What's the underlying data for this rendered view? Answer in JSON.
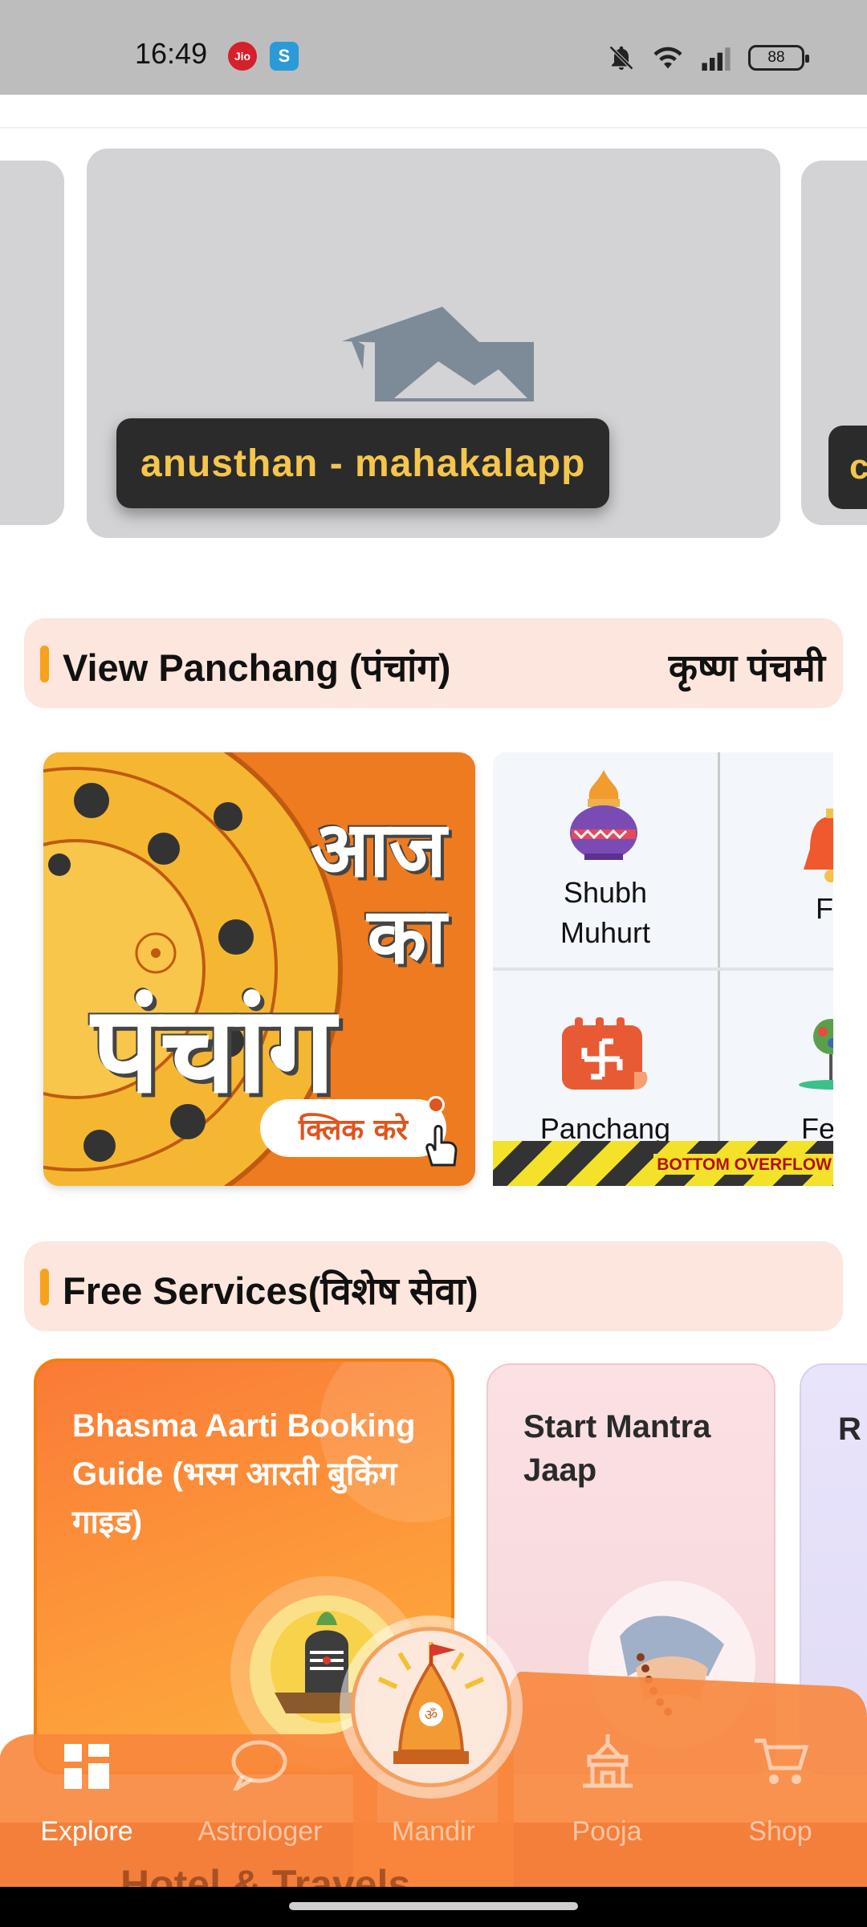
{
  "status_bar": {
    "time": "16:49",
    "carrier_badge": "Jio",
    "app_badge": "S",
    "battery": "88",
    "icons": [
      "mute-icon",
      "wifi-icon",
      "signal-icon",
      "battery-icon"
    ]
  },
  "carousel": {
    "main_caption": "anusthan - mahakalapp",
    "right_caption_partial": "c",
    "placeholder_icon": "image-placeholder-icon"
  },
  "panchang_section": {
    "title": "View Panchang (पंचांग)",
    "tithi": "कृष्ण पंचमी",
    "banner": {
      "line1": "आज",
      "line2": "का",
      "line3": "पंचांग",
      "button": "क्लिक करे"
    },
    "grid": [
      {
        "label_line1": "Shubh",
        "label_line2": "Muhurt",
        "icon": "kalash-icon"
      },
      {
        "label_line1": "Fa",
        "label_line2": "",
        "icon": "bell-icon"
      },
      {
        "label_line1": "Panchang",
        "label_line2": "",
        "icon": "calendar-swastik-icon"
      },
      {
        "label_line1": "Festi",
        "label_line2": "",
        "icon": "festival-icon"
      }
    ],
    "overflow_warning": "BOTTOM OVERFLOW"
  },
  "services_section": {
    "title": "Free Services(विशेष सेवा)",
    "cards": [
      {
        "title": "Bhasma Aarti Booking Guide (भस्म आरती बुकिंग गाइड)",
        "icon": "shivling-icon"
      },
      {
        "title": "Start Mantra Jaap",
        "icon": "prayer-beads-icon"
      },
      {
        "title": "R",
        "icon": ""
      }
    ]
  },
  "bottom_nav": {
    "items": [
      {
        "label": "Explore",
        "icon": "grid-icon",
        "active": true
      },
      {
        "label": "Astrologer",
        "icon": "chat-icon",
        "active": false
      },
      {
        "label": "Mandir",
        "icon": "temple-icon",
        "active": false
      },
      {
        "label": "Pooja",
        "icon": "pooja-icon",
        "active": false
      },
      {
        "label": "Shop",
        "icon": "cart-icon",
        "active": false
      }
    ],
    "peek_text": "Hotel & Travels"
  },
  "colors": {
    "accent": "#f58a3c",
    "section_bg": "#fde6dd",
    "caption_text": "#f4c64d"
  }
}
